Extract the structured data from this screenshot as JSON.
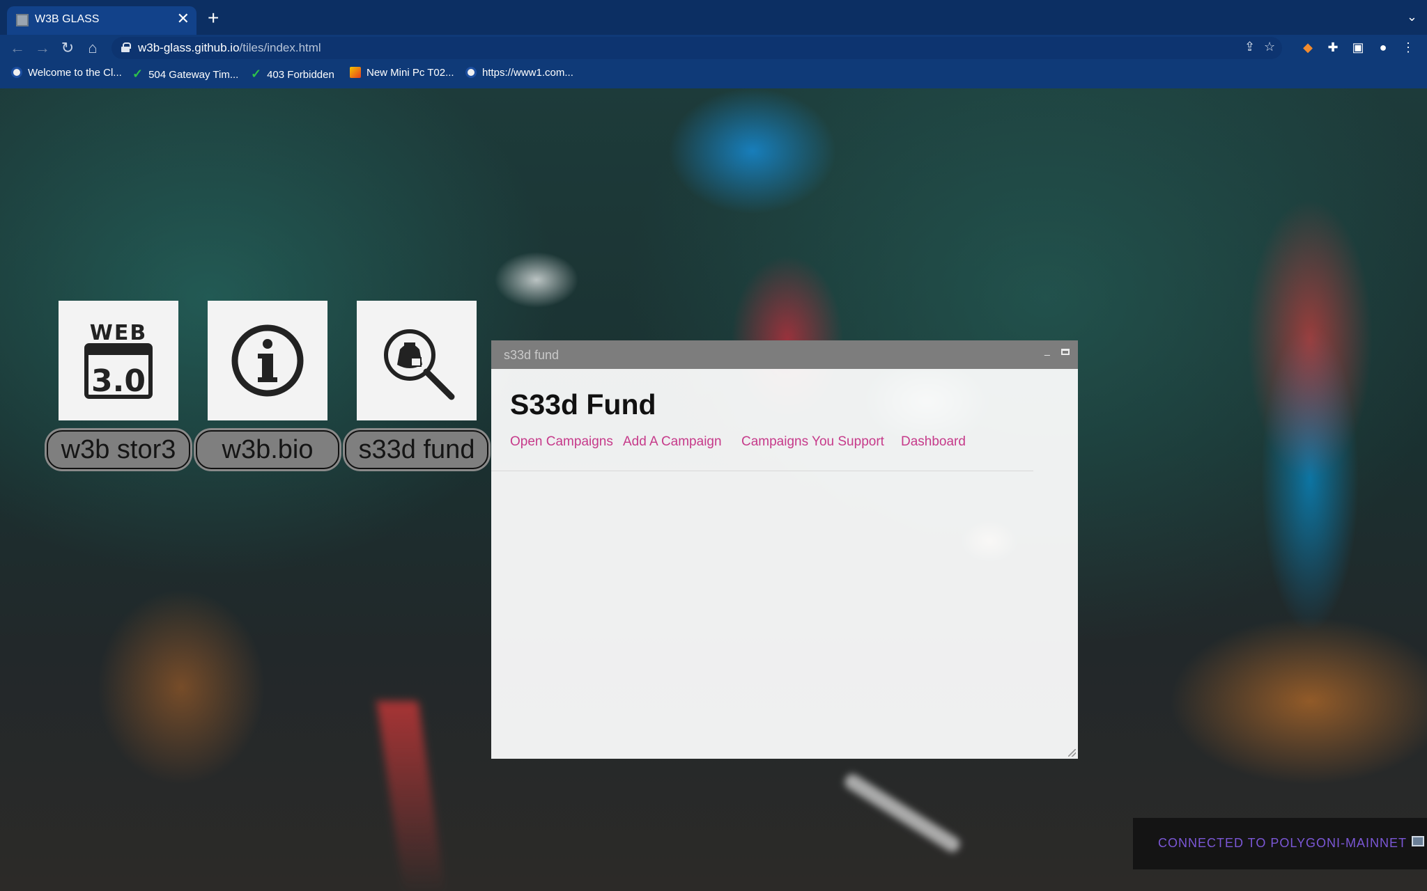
{
  "browser": {
    "tab": {
      "title": "W3B GLASS",
      "close": "✕"
    },
    "new_tab": "+",
    "tab_menu": "⌄",
    "url_host": "w3b-glass.github.io",
    "url_path": "/tiles/index.html",
    "nav": {
      "back": "←",
      "forward": "→",
      "reload": "↻",
      "home": "⌂"
    },
    "bookmarks": [
      {
        "label": "Welcome to the Cl...",
        "icon": "globe-icon"
      },
      {
        "label": "504 Gateway Tim...",
        "icon": "check-icon"
      },
      {
        "label": "403 Forbidden",
        "icon": "check-icon"
      },
      {
        "label": "New Mini Pc T02...",
        "icon": "game-icon"
      },
      {
        "label": "https://www1.com...",
        "icon": "globe-icon"
      }
    ],
    "check_glyph": "✓"
  },
  "desktop": {
    "apps": [
      {
        "label": "w3b stor3",
        "icon": "web3-icon",
        "icon_text_top": "WEB",
        "icon_text_bottom": "3.0"
      },
      {
        "label": "w3b.bio",
        "icon": "info-icon"
      },
      {
        "label": "s33d fund",
        "icon": "money-search-icon"
      }
    ]
  },
  "window": {
    "title": "s33d fund",
    "min": "_",
    "heading": "S33d Fund",
    "nav": [
      "Open Campaigns",
      "Add A Campaign",
      "Campaigns You Support",
      "Dashboard"
    ]
  },
  "status": {
    "text": "CONNECTED TO POLYGONI-MAINNET"
  },
  "colors": {
    "chrome_bg": "#0f3a78",
    "link_pink": "#c63a8a",
    "status_purple": "#7b57d6",
    "titlebar_gray": "#7d7d7d"
  }
}
